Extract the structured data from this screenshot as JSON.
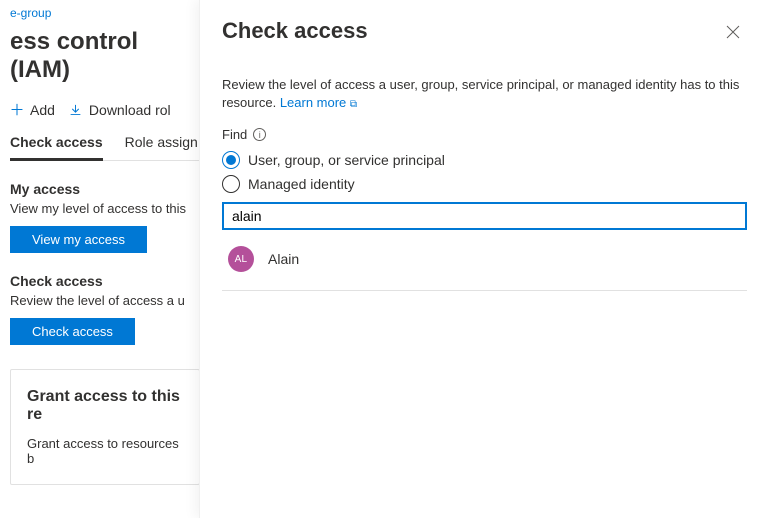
{
  "breadcrumb_tail": "e-group",
  "page_title_trunc": "ess control (IAM)",
  "toolbar": {
    "add_label": "Add",
    "download_label": "Download rol"
  },
  "tabs": {
    "check_access": "Check access",
    "role_assign": "Role assign"
  },
  "my_access": {
    "title": "My access",
    "desc": "View my level of access to this",
    "button": "View my access"
  },
  "check_access_sec": {
    "title": "Check access",
    "desc": "Review the level of access a u",
    "button": "Check access"
  },
  "grant_card": {
    "title": "Grant access to this re",
    "desc": "Grant access to resources b"
  },
  "flyout": {
    "title": "Check access",
    "desc_prefix": "Review the level of access a user, group, service principal, or managed identity has to this resource. ",
    "learn_more": "Learn more",
    "find_label": "Find",
    "radio_user": "User, group, or service principal",
    "radio_mi": "Managed identity",
    "search_value": "alain",
    "result": {
      "initials": "AL",
      "name": "Alain"
    }
  }
}
